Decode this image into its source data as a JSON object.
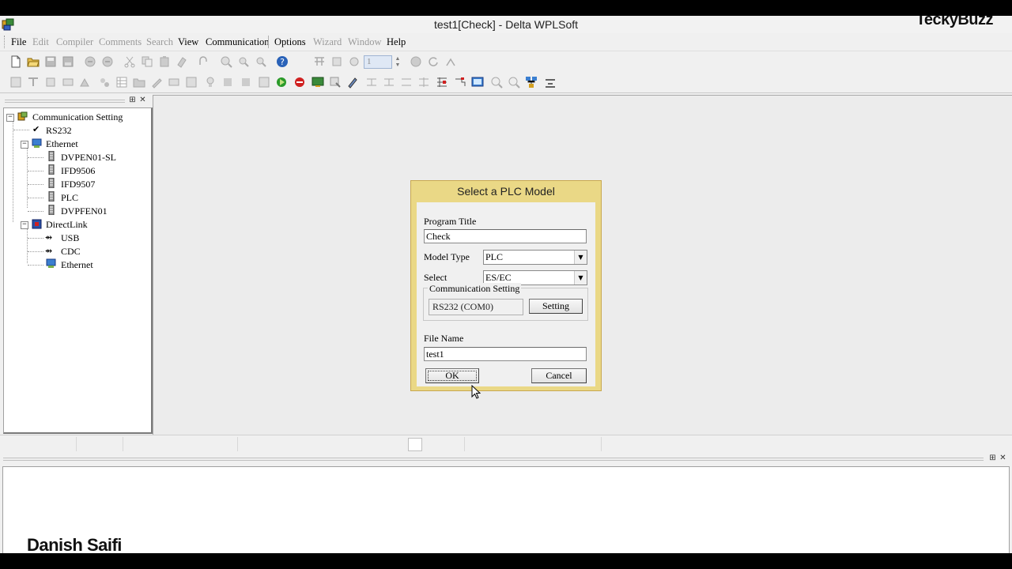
{
  "window": {
    "title": "test1[Check] - Delta WPLSoft"
  },
  "watermark": {
    "text": "TeckyBuzz"
  },
  "signature": {
    "text": "Danish Saifi"
  },
  "menubar": {
    "items": [
      {
        "label": "File",
        "enabled": true
      },
      {
        "label": "Edit",
        "enabled": false
      },
      {
        "label": "Compiler",
        "enabled": false
      },
      {
        "label": "Comments",
        "enabled": false
      },
      {
        "label": "Search",
        "enabled": false
      },
      {
        "label": "View",
        "enabled": true
      },
      {
        "label": "Communication",
        "enabled": true
      },
      {
        "label": "Options",
        "enabled": true
      },
      {
        "label": "Wizard",
        "enabled": false
      },
      {
        "label": "Window",
        "enabled": false
      },
      {
        "label": "Help",
        "enabled": true
      }
    ]
  },
  "toolbar": {
    "step_value": "1"
  },
  "tree": {
    "root": "Communication Setting",
    "rs232": "RS232",
    "ethernet": "Ethernet",
    "ethernet_children": [
      "DVPEN01-SL",
      "IFD9506",
      "IFD9507",
      "PLC",
      "DVPFEN01"
    ],
    "directlink": "DirectLink",
    "directlink_children": [
      "USB",
      "CDC",
      "Ethernet"
    ]
  },
  "dialog": {
    "title": "Select a PLC Model",
    "program_title_label": "Program Title",
    "program_title_value": "Check",
    "model_type_label": "Model Type",
    "model_type_value": "PLC",
    "select_label": "Select",
    "select_value": "ES/EC",
    "comm_group_label": "Communication Setting",
    "comm_value": "RS232 (COM0)",
    "setting_button": "Setting",
    "file_name_label": "File Name",
    "file_name_value": "test1",
    "ok_button": "OK",
    "cancel_button": "Cancel"
  },
  "colors": {
    "dialog_frame": "#ead886",
    "workspace": "#ececec"
  }
}
